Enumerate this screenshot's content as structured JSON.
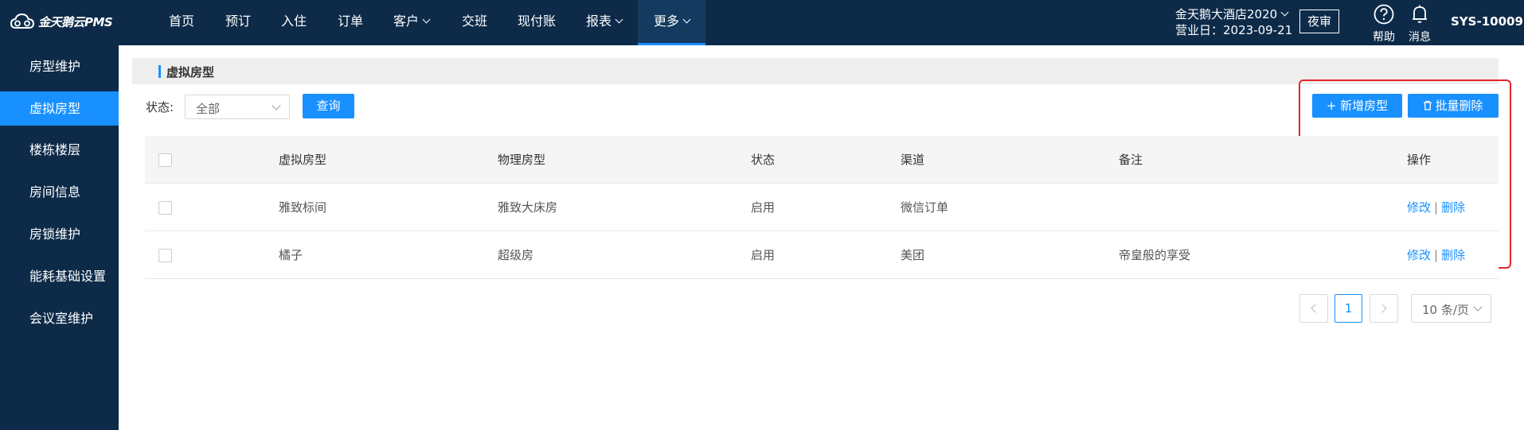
{
  "app": {
    "logo_text": "金天鹅云PMS"
  },
  "nav": {
    "items": [
      {
        "label": "首页"
      },
      {
        "label": "预订"
      },
      {
        "label": "入住"
      },
      {
        "label": "订单"
      },
      {
        "label": "客户"
      },
      {
        "label": "交班"
      },
      {
        "label": "现付账"
      },
      {
        "label": "报表"
      },
      {
        "label": "更多"
      }
    ]
  },
  "header": {
    "hotel_name": "金天鹅大酒店2020",
    "business_date_label": "营业日：2023-09-21",
    "audit_button": "夜审",
    "help_label": "帮助",
    "messages_label": "消息",
    "user": "SYS-10009"
  },
  "sidebar": {
    "items": [
      {
        "label": "房型维护"
      },
      {
        "label": "虚拟房型"
      },
      {
        "label": "楼栋楼层"
      },
      {
        "label": "房间信息"
      },
      {
        "label": "房锁维护"
      },
      {
        "label": "能耗基础设置"
      },
      {
        "label": "会议室维护"
      }
    ]
  },
  "main": {
    "section_title": "虚拟房型",
    "filter": {
      "status_label": "状态:",
      "status_value": "全部",
      "query_button": "查询"
    },
    "actions": {
      "add_button": "+ 新增房型",
      "batch_delete_button": "批量删除"
    },
    "table": {
      "columns": [
        "虚拟房型",
        "物理房型",
        "状态",
        "渠道",
        "备注",
        "操作"
      ],
      "rows": [
        {
          "virtual_type": "雅致标间",
          "physical_type": "雅致大床房",
          "status": "启用",
          "channel": "微信订单",
          "remark": "",
          "edit": "修改",
          "sep": "|",
          "delete": "删除"
        },
        {
          "virtual_type": "橘子",
          "physical_type": "超级房",
          "status": "启用",
          "channel": "美团",
          "remark": "帝皇般的享受",
          "edit": "修改",
          "sep": "|",
          "delete": "删除"
        }
      ]
    },
    "pagination": {
      "current_page": "1",
      "page_size": "10 条/页"
    }
  },
  "colors": {
    "topbar": "#0d2b49",
    "accent": "#1890ff",
    "highlight_box": "#e3262b"
  }
}
